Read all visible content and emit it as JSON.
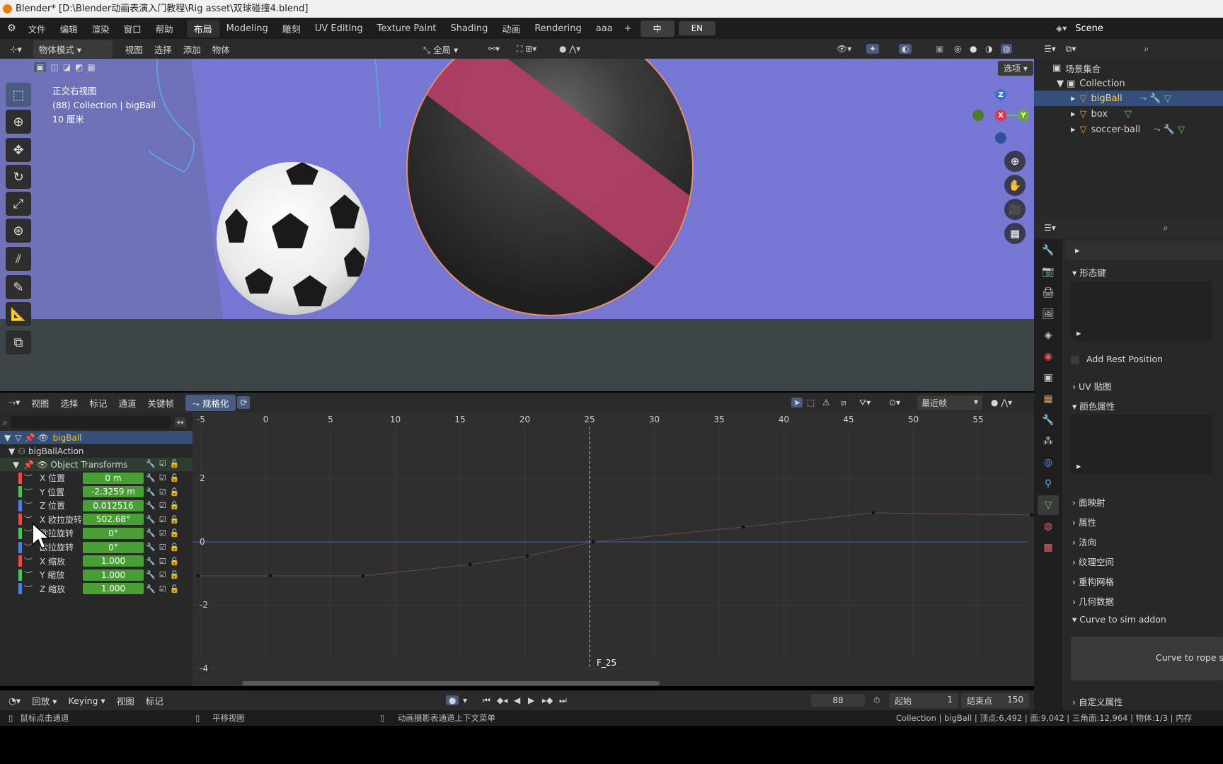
{
  "window_title": "Blender* [D:\\Blender动画表演入门教程\\Rig asset\\双球碰撞4.blend]",
  "top_menu": [
    "文件",
    "编辑",
    "渲染",
    "窗口",
    "帮助"
  ],
  "workspaces": [
    "布局",
    "Modeling",
    "雕刻",
    "UV Editing",
    "Texture Paint",
    "Shading",
    "动画",
    "Rendering",
    "aaa"
  ],
  "active_workspace": "布局",
  "lang_buttons": [
    "中",
    "EN"
  ],
  "scene_name": "Scene",
  "viewport": {
    "mode": "物体模式",
    "menus": [
      "视图",
      "选择",
      "添加",
      "物体"
    ],
    "orientation": "全局",
    "options_label": "选项",
    "info_view": "正交右视图",
    "info_collection": "(88) Collection | bigBall",
    "info_scale": "10 厘米",
    "axes": {
      "x": "X",
      "y": "Y",
      "z": "Z"
    }
  },
  "outliner": {
    "root": "场景集合",
    "collection": "Collection",
    "items": [
      "bigBall",
      "box",
      "soccer-ball"
    ]
  },
  "properties": {
    "shape_keys": "形态键",
    "add_rest_position": "Add Rest Position",
    "uv_maps": "UV 贴图",
    "color_attributes": "颜色属性",
    "face_maps": "面映射",
    "attributes": "属性",
    "normals": "法向",
    "texture_space": "纹理空间",
    "remesh": "重构网格",
    "geometry_data": "几何数据",
    "curve_to_sim": "Curve to sim addon",
    "curve_to_rope_btn": "Curve to rope si",
    "custom_props": "自定义属性"
  },
  "graph_editor": {
    "menus": [
      "视图",
      "选择",
      "标记",
      "通道",
      "关键帧"
    ],
    "normalize": "规格化",
    "pivot": "最近帧",
    "frame_ticks": [
      "-5",
      "0",
      "5",
      "10",
      "15",
      "20",
      "25",
      "30",
      "35",
      "40",
      "45",
      "50",
      "55"
    ],
    "value_ticks": [
      "2",
      "0",
      "-2",
      "-4"
    ],
    "current_frame_label": "F_25",
    "object": "bigBall",
    "action": "bigBallAction",
    "group": "Object Transforms",
    "channels": [
      {
        "name": "X 位置",
        "value": "0 m",
        "color": "#e34a4a"
      },
      {
        "name": "Y 位置",
        "value": "-2.3259 m",
        "color": "#4ac25a"
      },
      {
        "name": "Z 位置",
        "value": "0.012516",
        "color": "#4a7ee3"
      },
      {
        "name": "X 欧拉旋转",
        "value": "502.68°",
        "color": "#e34a4a"
      },
      {
        "name": "欧拉旋转",
        "value": "0°",
        "color": "#4ac25a"
      },
      {
        "name": "欧拉旋转",
        "value": "0°",
        "color": "#4a7ee3"
      },
      {
        "name": "X 缩放",
        "value": "1.000",
        "color": "#e34a4a"
      },
      {
        "name": "Y 缩放",
        "value": "1.000",
        "color": "#4ac25a"
      },
      {
        "name": "Z 缩放",
        "value": "1.000",
        "color": "#4a7ee3"
      }
    ]
  },
  "timeline": {
    "playback": "回放",
    "keying": "Keying",
    "menus": [
      "视图",
      "标记"
    ],
    "current_frame": "88",
    "start_label": "起始",
    "start": "1",
    "end_label": "结束点",
    "end": "150"
  },
  "status": {
    "left": "鼠标点击通道",
    "middle": "平移视图",
    "right_hint": "动画摄影表通道上下文菜单",
    "stats": "Collection | bigBall | 顶点:6,492 | 面:9,042 | 三角面:12,964 | 物体:1/3 | 内存"
  },
  "colors": {
    "accent": "#4a5b80",
    "green_value": "#4a9e36",
    "viewport_bg": "#7677d3",
    "big_ball_stripe": "#b13e65"
  }
}
